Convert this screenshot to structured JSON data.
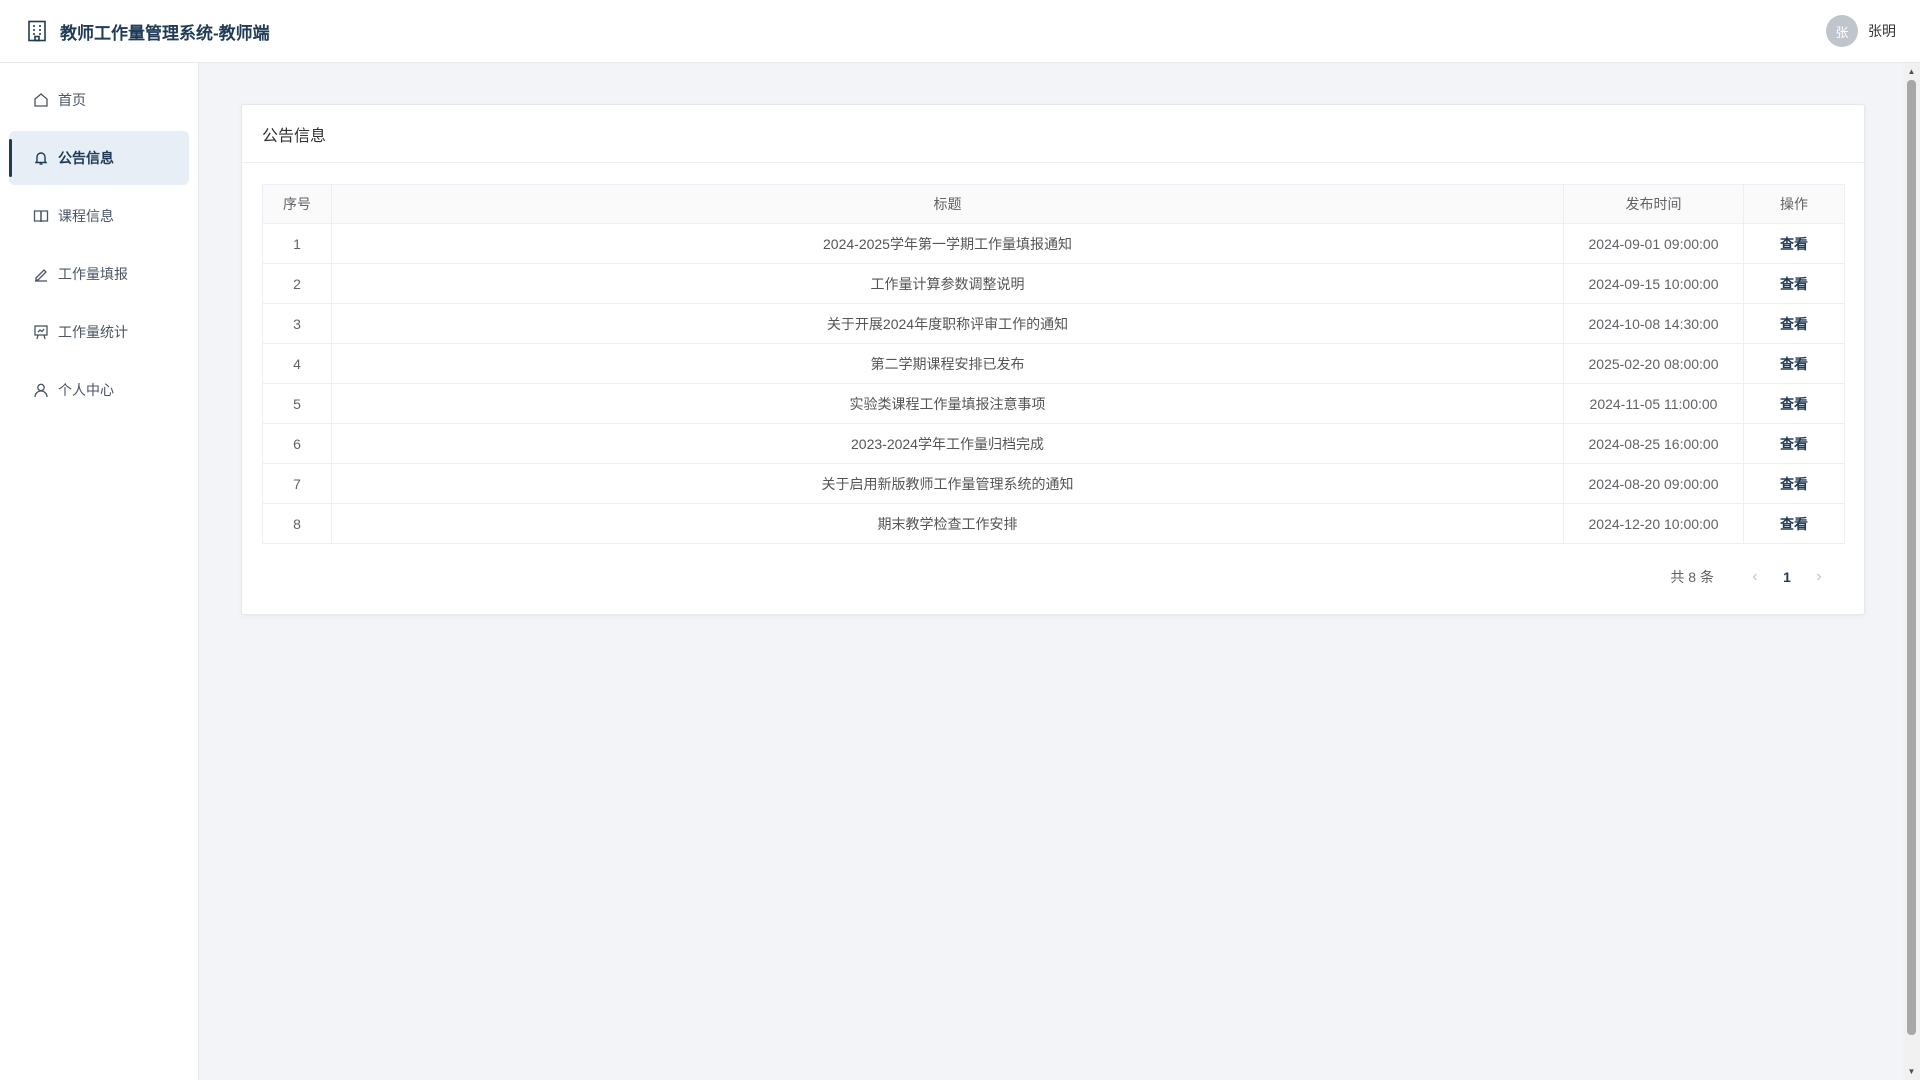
{
  "header": {
    "title": "教师工作量管理系统-教师端",
    "avatar_text": "张",
    "username": "张明"
  },
  "sidebar": {
    "items": [
      {
        "label": "首页",
        "icon": "home-icon"
      },
      {
        "label": "公告信息",
        "icon": "bell-icon",
        "active": true
      },
      {
        "label": "课程信息",
        "icon": "book-icon"
      },
      {
        "label": "工作量填报",
        "icon": "pen-icon"
      },
      {
        "label": "工作量统计",
        "icon": "chart-board-icon"
      },
      {
        "label": "个人中心",
        "icon": "user-icon"
      }
    ]
  },
  "main": {
    "card_title": "公告信息",
    "table": {
      "headers": [
        "序号",
        "标题",
        "发布时间",
        "操作"
      ],
      "rows": [
        {
          "index": "1",
          "title": "2024-2025学年第一学期工作量填报通知",
          "time": "2024-09-01 09:00:00",
          "action": "查看"
        },
        {
          "index": "2",
          "title": "工作量计算参数调整说明",
          "time": "2024-09-15 10:00:00",
          "action": "查看"
        },
        {
          "index": "3",
          "title": "关于开展2024年度职称评审工作的通知",
          "time": "2024-10-08 14:30:00",
          "action": "查看"
        },
        {
          "index": "4",
          "title": "第二学期课程安排已发布",
          "time": "2025-02-20 08:00:00",
          "action": "查看"
        },
        {
          "index": "5",
          "title": "实验类课程工作量填报注意事项",
          "time": "2024-11-05 11:00:00",
          "action": "查看"
        },
        {
          "index": "6",
          "title": "2023-2024学年工作量归档完成",
          "time": "2024-08-25 16:00:00",
          "action": "查看"
        },
        {
          "index": "7",
          "title": "关于启用新版教师工作量管理系统的通知",
          "time": "2024-08-20 09:00:00",
          "action": "查看"
        },
        {
          "index": "8",
          "title": "期末教学检查工作安排",
          "time": "2024-12-20 10:00:00",
          "action": "查看"
        }
      ]
    },
    "pagination": {
      "total_text": "共 8 条",
      "current_page": "1",
      "prev_symbol": "‹",
      "next_symbol": "›"
    }
  },
  "colors": {
    "brand": "#1f3b57",
    "active_bg": "#e8eef5",
    "page_bg": "#f2f4f7"
  }
}
